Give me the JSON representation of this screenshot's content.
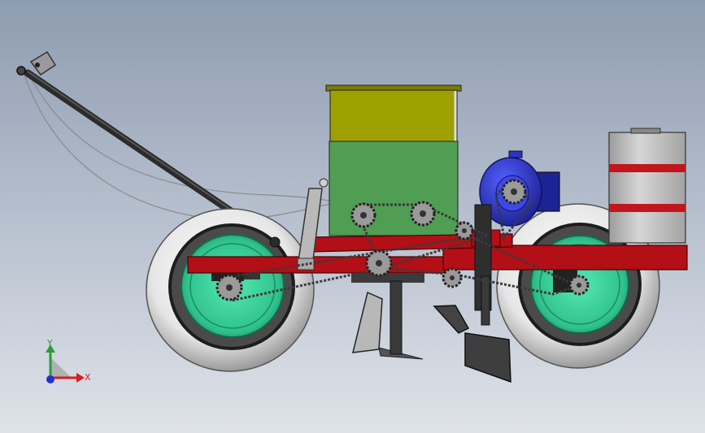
{
  "triad": {
    "y_label": "Y",
    "x_label": "X",
    "y_color": "#2f9a3a",
    "x_color": "#d62020",
    "z_color": "#2233cc"
  },
  "colors": {
    "frame": "#b30f16",
    "hopper_upper": "#9ea000",
    "hopper_lower": "#4f9e54",
    "tire": "#e9e9e9",
    "rim": "#36d29c",
    "motor": "#2a33c8",
    "tank": "#c4c4c4",
    "tank_band": "#c0161c",
    "drawbar": "#2b2b2b",
    "chain": "#3a3a3a"
  }
}
